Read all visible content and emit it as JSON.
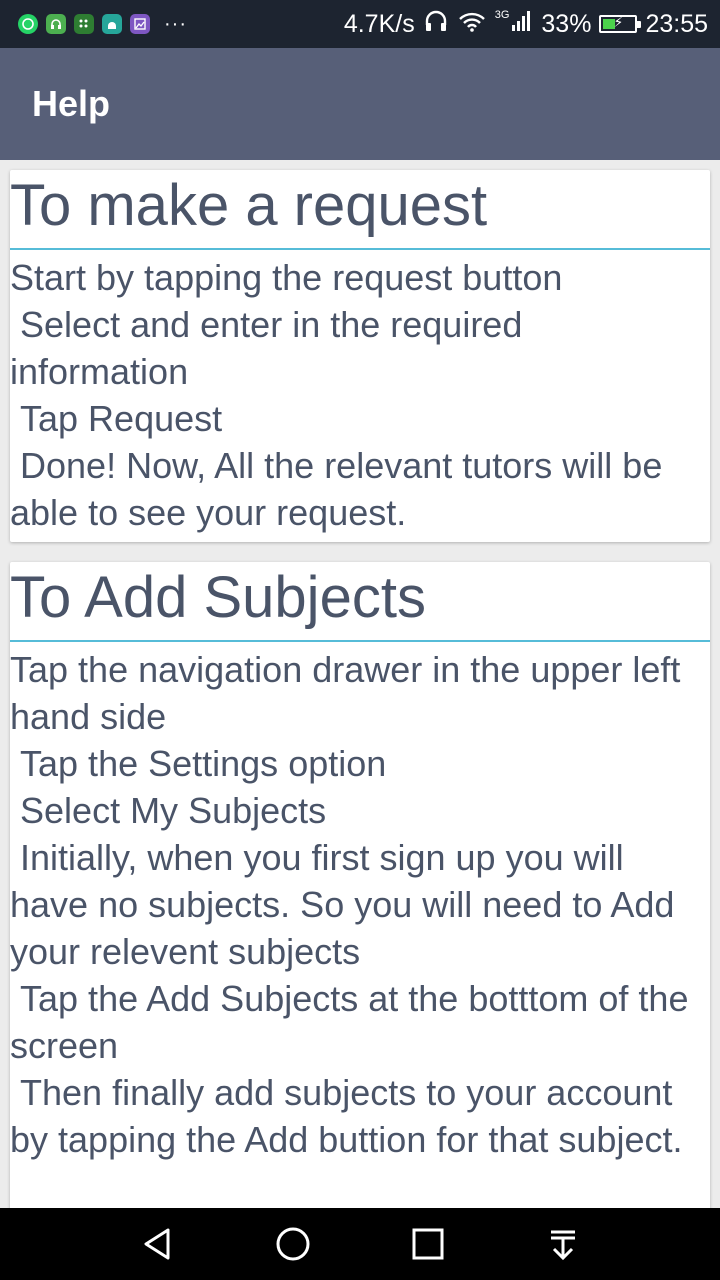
{
  "status_bar": {
    "notifications": [
      {
        "name": "whatsapp-icon",
        "color": "#25d366"
      },
      {
        "name": "headset-app-icon",
        "color": "#4caf50"
      },
      {
        "name": "blackberry-messenger-icon",
        "color": "#2e7d32"
      },
      {
        "name": "android-app-icon",
        "color": "#26a69a"
      },
      {
        "name": "gallery-app-icon",
        "color": "#7e57c2"
      }
    ],
    "more": "···",
    "net_speed": "4.7K/s",
    "network_type": "3G",
    "battery": "33%",
    "battery_level": 0.33,
    "time": "23:55"
  },
  "app_bar": {
    "title": "Help",
    "color": "#575f78"
  },
  "cards": [
    {
      "title": "To make a request",
      "body": "Start by tapping the request button\n Select and enter in the required information\n Tap Request\n Done! Now, All the relevant tutors will be able to see your request."
    },
    {
      "title": "To Add Subjects",
      "body": "Tap the navigation drawer in the upper left hand side\n Tap the Settings option\n Select My Subjects\n Initially, when you first sign up you will have no subjects. So you will need to Add your relevent subjects\n Tap the Add Subjects at the botttom of the screen\n Then finally add subjects to your account by tapping the Add buttion for that subject."
    }
  ],
  "accent_color": "#56bcd8",
  "nav_bar": {
    "buttons": [
      "back-icon",
      "home-icon",
      "recents-icon",
      "notification-shade-icon"
    ]
  }
}
